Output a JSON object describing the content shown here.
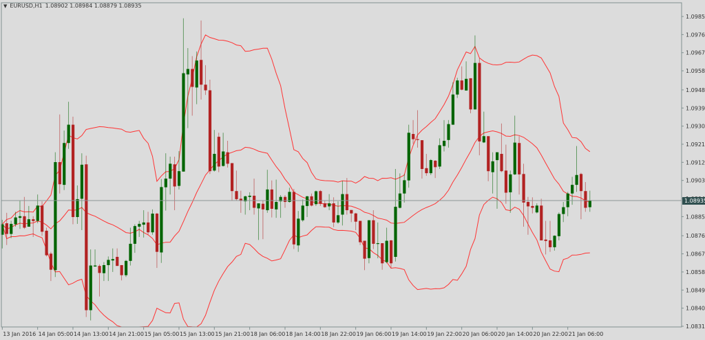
{
  "header": {
    "symbol": "EURUSD,H1",
    "ohlc": "1.08902 1.08984 1.08879 1.08935",
    "menu_icon": "triangle-down-icon"
  },
  "colors": {
    "background": "#dcdcdc",
    "frame": "#7f8f8f",
    "bull": "#006400",
    "bear": "#b22222",
    "bands": "#ff3333",
    "price_line": "#8c9696",
    "price_tag": "#2f4f4f"
  },
  "chart_data": {
    "type": "candlestick",
    "symbol": "EURUSD",
    "timeframe": "H1",
    "indicator": {
      "name": "Bollinger Bands",
      "period": 20,
      "deviation": 2
    },
    "price_scale": 100000,
    "ylim": [
      1.0831,
      1.0985
    ],
    "current_price": "1.08935",
    "y_ticks": [
      "1.09850",
      "1.09760",
      "1.09670",
      "1.09580",
      "1.09485",
      "1.09395",
      "1.09305",
      "1.09215",
      "1.09125",
      "1.09035",
      "1.08945",
      "1.08855",
      "1.08760",
      "1.08670",
      "1.08580",
      "1.08490",
      "1.08400",
      "1.08310"
    ],
    "x_ticks": [
      {
        "bar": 0,
        "label": "13 Jan 2016"
      },
      {
        "bar": 8,
        "label": "14 Jan 05:00"
      },
      {
        "bar": 16,
        "label": "14 Jan 13:00"
      },
      {
        "bar": 24,
        "label": "14 Jan 21:00"
      },
      {
        "bar": 32,
        "label": "15 Jan 05:00"
      },
      {
        "bar": 40,
        "label": "15 Jan 13:00"
      },
      {
        "bar": 48,
        "label": "15 Jan 21:00"
      },
      {
        "bar": 56,
        "label": "18 Jan 06:00"
      },
      {
        "bar": 64,
        "label": "18 Jan 14:00"
      },
      {
        "bar": 72,
        "label": "18 Jan 22:00"
      },
      {
        "bar": 80,
        "label": "19 Jan 06:00"
      },
      {
        "bar": 88,
        "label": "19 Jan 14:00"
      },
      {
        "bar": 96,
        "label": "19 Jan 22:00"
      },
      {
        "bar": 104,
        "label": "20 Jan 06:00"
      },
      {
        "bar": 112,
        "label": "20 Jan 14:00"
      },
      {
        "bar": 120,
        "label": "20 Jan 22:00"
      },
      {
        "bar": 128,
        "label": "21 Jan 06:00"
      }
    ],
    "ohlc_points": [
      [
        108765,
        108839,
        108697,
        108817
      ],
      [
        108822,
        108874,
        108714,
        108769
      ],
      [
        108769,
        108834,
        108748,
        108819
      ],
      [
        108817,
        108879,
        108805,
        108851
      ],
      [
        108849,
        108936,
        108794,
        108857
      ],
      [
        108857,
        108953,
        108794,
        108800
      ],
      [
        108805,
        108908,
        108805,
        108842
      ],
      [
        108842,
        108857,
        108754,
        108833
      ],
      [
        108834,
        108965,
        108822,
        108910
      ],
      [
        108910,
        108931,
        108760,
        108780
      ],
      [
        108785,
        108800,
        108657,
        108663
      ],
      [
        108671,
        108680,
        108535,
        108591
      ],
      [
        108589,
        109175,
        108555,
        109126
      ],
      [
        109126,
        109363,
        108970,
        109016
      ],
      [
        109013,
        109283,
        108987,
        109221
      ],
      [
        109221,
        109426,
        109192,
        109312
      ],
      [
        109312,
        109352,
        108817,
        108853
      ],
      [
        108853,
        109010,
        108819,
        108942
      ],
      [
        108944,
        109170,
        108788,
        109113
      ],
      [
        109115,
        109158,
        108356,
        108390
      ],
      [
        108390,
        108692,
        108339,
        108612
      ],
      [
        108607,
        108692,
        108606,
        108612
      ],
      [
        108610,
        108618,
        108458,
        108575
      ],
      [
        108574,
        108629,
        108535,
        108614
      ],
      [
        108614,
        108657,
        108535,
        108640
      ],
      [
        108637,
        108697,
        108580,
        108644
      ],
      [
        108655,
        108697,
        108610,
        108610
      ],
      [
        108614,
        108614,
        108538,
        108564
      ],
      [
        108564,
        108640,
        108555,
        108635
      ],
      [
        108635,
        108800,
        108612,
        108720
      ],
      [
        108720,
        108817,
        108675,
        108808
      ],
      [
        108805,
        108834,
        108754,
        108819
      ],
      [
        108815,
        108887,
        108751,
        108826
      ],
      [
        108826,
        108879,
        108765,
        108777
      ],
      [
        108777,
        108891,
        108765,
        108870
      ],
      [
        108870,
        108874,
        108600,
        108680
      ],
      [
        108677,
        109042,
        108625,
        109002
      ],
      [
        109001,
        109170,
        108885,
        109044
      ],
      [
        109044,
        109153,
        108965,
        109118
      ],
      [
        109115,
        109153,
        108887,
        109005
      ],
      [
        109008,
        109181,
        108990,
        109081
      ],
      [
        109079,
        109841,
        109079,
        109568
      ],
      [
        109562,
        109693,
        109295,
        109589
      ],
      [
        109589,
        109653,
        109357,
        109500
      ],
      [
        109497,
        109676,
        109414,
        109631
      ],
      [
        109634,
        109830,
        109437,
        109511
      ],
      [
        109511,
        109608,
        109460,
        109483
      ],
      [
        109483,
        109536,
        109067,
        109081
      ],
      [
        109084,
        109286,
        109079,
        109167
      ],
      [
        109252,
        109272,
        109076,
        109104
      ],
      [
        109107,
        109272,
        109104,
        109179
      ],
      [
        109175,
        109232,
        109099,
        109118
      ],
      [
        109121,
        109121,
        108936,
        108982
      ],
      [
        108982,
        109084,
        108936,
        108942
      ],
      [
        108944,
        108984,
        108874,
        108933
      ],
      [
        108931,
        108959,
        108865,
        108956
      ],
      [
        108953,
        108976,
        108887,
        108959
      ],
      [
        108959,
        109044,
        108865,
        108899
      ],
      [
        108896,
        108921,
        108739,
        108921
      ],
      [
        108919,
        108936,
        108743,
        108891
      ],
      [
        108887,
        109088,
        108874,
        108990
      ],
      [
        108990,
        109035,
        108851,
        108894
      ],
      [
        108891,
        109039,
        108849,
        108928
      ],
      [
        108931,
        108962,
        108849,
        108953
      ],
      [
        108953,
        108962,
        108899,
        108928
      ],
      [
        108928,
        108999,
        108925,
        108978
      ],
      [
        108978,
        108993,
        108694,
        108717
      ],
      [
        108712,
        108883,
        108680,
        108845
      ],
      [
        108837,
        108940,
        108830,
        108910
      ],
      [
        108908,
        108958,
        108853,
        108956
      ],
      [
        108956,
        108970,
        108906,
        108910
      ],
      [
        108917,
        108985,
        108908,
        108981
      ],
      [
        108982,
        108987,
        108908,
        108919
      ],
      [
        108921,
        108933,
        108899,
        108902
      ],
      [
        108906,
        108967,
        108887,
        108921
      ],
      [
        108921,
        108951,
        108803,
        108826
      ],
      [
        108826,
        108931,
        108819,
        108862
      ],
      [
        108865,
        109033,
        108811,
        108967
      ],
      [
        108967,
        109047,
        108865,
        108887
      ],
      [
        108888,
        108888,
        108828,
        108871
      ],
      [
        108871,
        108874,
        108788,
        108830
      ],
      [
        108834,
        108834,
        108714,
        108728
      ],
      [
        108735,
        108735,
        108589,
        108646
      ],
      [
        108649,
        108837,
        108623,
        108837
      ],
      [
        108837,
        108887,
        108694,
        108720
      ],
      [
        108719,
        108826,
        108648,
        108723
      ],
      [
        108723,
        108723,
        108591,
        108623
      ],
      [
        108629,
        108800,
        108623,
        108735
      ],
      [
        108737,
        108739,
        108598,
        108623
      ],
      [
        108655,
        109092,
        108632,
        108904
      ],
      [
        108899,
        109070,
        108896,
        108970
      ],
      [
        108970,
        109067,
        108925,
        109036
      ],
      [
        109035,
        109312,
        108999,
        109272
      ],
      [
        109266,
        109335,
        109217,
        109240
      ],
      [
        109240,
        109384,
        109198,
        109236
      ],
      [
        109235,
        109235,
        109044,
        109092
      ],
      [
        109096,
        109167,
        109058,
        109071
      ],
      [
        109071,
        109141,
        109062,
        109136
      ],
      [
        109133,
        109136,
        109047,
        109101
      ],
      [
        109104,
        109244,
        109092,
        109210
      ],
      [
        109206,
        109335,
        109179,
        109232
      ],
      [
        109236,
        109335,
        109198,
        109315
      ],
      [
        109312,
        109523,
        109312,
        109462
      ],
      [
        109462,
        109545,
        109445,
        109532
      ],
      [
        109532,
        109602,
        109483,
        109486
      ],
      [
        109482,
        109627,
        109482,
        109540
      ],
      [
        109543,
        109543,
        109369,
        109388
      ],
      [
        109388,
        109756,
        109388,
        109619
      ],
      [
        109619,
        109642,
        109160,
        109229
      ],
      [
        109224,
        109377,
        109221,
        109255
      ],
      [
        109255,
        109255,
        109031,
        109081
      ],
      [
        109076,
        109175,
        108970,
        109130
      ],
      [
        109136,
        109175,
        108894,
        109175
      ],
      [
        109167,
        109318,
        109076,
        109081
      ],
      [
        109084,
        109213,
        108919,
        108974
      ],
      [
        108976,
        109084,
        108874,
        109065
      ],
      [
        109065,
        109357,
        109062,
        109223
      ],
      [
        109221,
        109255,
        108965,
        109065
      ],
      [
        109067,
        109118,
        108805,
        108925
      ],
      [
        108928,
        108953,
        108765,
        108906
      ],
      [
        108908,
        108951,
        108871,
        108899
      ],
      [
        108876,
        108921,
        108871,
        108910
      ],
      [
        108910,
        108944,
        108737,
        108737
      ],
      [
        108741,
        108834,
        108667,
        108734
      ],
      [
        108737,
        108834,
        108680,
        108703
      ],
      [
        108703,
        108762,
        108686,
        108760
      ],
      [
        108758,
        108876,
        108737,
        108868
      ],
      [
        108868,
        108928,
        108828,
        108902
      ],
      [
        108902,
        108978,
        108857,
        108970
      ],
      [
        108970,
        109053,
        108914,
        109013
      ],
      [
        109013,
        109206,
        108978,
        109062
      ],
      [
        109067,
        109073,
        108842,
        108982
      ],
      [
        108982,
        109027,
        108879,
        108899
      ],
      [
        108902,
        108984,
        108879,
        108935
      ]
    ]
  }
}
